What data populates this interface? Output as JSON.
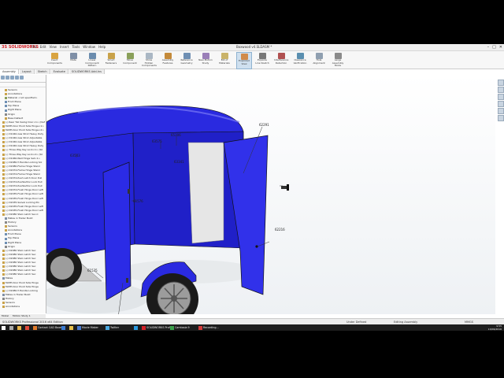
{
  "app": {
    "logo": "3S SOLIDWORKS",
    "document_title": "Boxwood v4.SLDASM *"
  },
  "menu": [
    "File",
    "Edit",
    "View",
    "Insert",
    "Tools",
    "Window",
    "Help"
  ],
  "window_controls": [
    "–",
    "□",
    "✕"
  ],
  "ribbon": [
    {
      "label": "Insert Components",
      "icon": "insert-components-icon",
      "color": "#d9a441"
    },
    {
      "label": "Mate",
      "icon": "mate-icon",
      "color": "#7f8fa6"
    },
    {
      "label": "Linear Component Pattern",
      "icon": "linear-pattern-icon",
      "color": "#6b8cae"
    },
    {
      "label": "Smart Fasteners",
      "icon": "smart-fasteners-icon",
      "color": "#c9a24a"
    },
    {
      "label": "Move Component",
      "icon": "move-component-icon",
      "color": "#8aa05a"
    },
    {
      "label": "Show Hidden Components",
      "icon": "show-hidden-icon",
      "color": "#aab7c4"
    },
    {
      "label": "Assembly Features",
      "icon": "assembly-features-icon",
      "color": "#c48a3a"
    },
    {
      "label": "Reference Geometry",
      "icon": "reference-geometry-icon",
      "color": "#6f8fb3"
    },
    {
      "label": "New Motion Study",
      "icon": "motion-study-icon",
      "color": "#9a7fb8"
    },
    {
      "label": "Bill of Materials",
      "icon": "bill-of-materials-icon",
      "color": "#c9b36a"
    },
    {
      "label": "Exploded View",
      "icon": "exploded-view-icon",
      "color": "#d08a4a"
    },
    {
      "label": "Explode Line Sketch",
      "icon": "explode-line-sketch-icon",
      "color": "#777777"
    },
    {
      "label": "Interference Detection",
      "icon": "interference-icon",
      "color": "#b05050"
    },
    {
      "label": "Clearance Verification",
      "icon": "clearance-icon",
      "color": "#5a8fb0"
    },
    {
      "label": "Hole Alignment",
      "icon": "hole-alignment-icon",
      "color": "#8f9fb0"
    },
    {
      "label": "Large Assembly Mode",
      "icon": "large-assembly-icon",
      "color": "#8a8a8a"
    }
  ],
  "command_tabs": [
    "Assembly",
    "Layout",
    "Sketch",
    "Evaluate",
    "SOLIDWORKS Add-Ins"
  ],
  "tree": [
    {
      "label": "Sensors",
      "color": "#c9a24a"
    },
    {
      "label": "Annotations",
      "color": "#c9a24a"
    },
    {
      "label": "Material <not specified>",
      "color": "#8aa05a"
    },
    {
      "label": "Front Plane",
      "color": "#6f8fb3"
    },
    {
      "label": "Top Plane",
      "color": "#6f8fb3"
    },
    {
      "label": "Right Plane",
      "color": "#6f8fb3"
    },
    {
      "label": "Origin",
      "color": "#888888"
    },
    {
      "label": "Base Default",
      "color": "#c9a24a"
    },
    {
      "label": "(-) Rear Tub Swing Door<1> (Def",
      "color": "#c9a24a"
    },
    {
      "label": "MATE-Door Pivot Side Hinge<1>",
      "color": "#c9a24a"
    },
    {
      "label": "MATE-Door Pivot Side Hinge<2>",
      "color": "#c9a24a"
    },
    {
      "label": "(-) D1040-Gas Strut Heavy Duty",
      "color": "#c9a24a"
    },
    {
      "label": "(-) D1040-Gas Strut Adjustable",
      "color": "#c9a24a"
    },
    {
      "label": "(-) D1040-Gas Strut Adjustable",
      "color": "#c9a24a"
    },
    {
      "label": "(-) D1040-Gas Strut Heavy Duty",
      "color": "#c9a24a"
    },
    {
      "label": "(-) Three Way Key Lock<1> (Sil",
      "color": "#c9a24a"
    },
    {
      "label": "(-) Three Way Key Lock<2> (Sil",
      "color": "#c9a24a"
    },
    {
      "label": "(-) D1060-Wall Hinge Set<1>",
      "color": "#c9a24a"
    },
    {
      "label": "(-) D2080-T-Handle Locking Sol",
      "color": "#c9a24a"
    },
    {
      "label": "(-) D2080-Flame Hinge Stainl",
      "color": "#c9a24a"
    },
    {
      "label": "(-) D2074-Flame Hinge Stainl",
      "color": "#c9a24a"
    },
    {
      "label": "(-) D2074-Flame Hinge Stainl",
      "color": "#c9a24a"
    },
    {
      "label": "(-) D2074-Push Latch Door Pull",
      "color": "#c9a24a"
    },
    {
      "label": "(-) D2074-Pushbutton Lock Pull",
      "color": "#c9a24a"
    },
    {
      "label": "(-) D2074-Pushbutton Lock Pull",
      "color": "#c9a24a"
    },
    {
      "label": "(-) D2074-Flush Hinge Door Left",
      "color": "#c9a24a"
    },
    {
      "label": "(-) D2035-Flush Hinge Door Left",
      "color": "#c9a24a"
    },
    {
      "label": "(-) D2035-Flush Hinge Door Left",
      "color": "#c9a24a"
    },
    {
      "label": "(-) D2035-Swivel Locking Pin",
      "color": "#c9a24a"
    },
    {
      "label": "(-) D2035-Flush Hinge Door Left",
      "color": "#c9a24a"
    },
    {
      "label": "(-) D2035-Flush Hinge Door Left",
      "color": "#c9a24a"
    },
    {
      "label": "(-) D2080 Stain Latch Sec-C",
      "color": "#c9a24a"
    },
    {
      "label": "Mates in Trailer Build",
      "color": "#7f8fa6"
    },
    {
      "label": "History",
      "color": "#888888"
    },
    {
      "label": "Sensors",
      "color": "#c9a24a"
    },
    {
      "label": "Annotations",
      "color": "#c9a24a"
    },
    {
      "label": "Front Plane",
      "color": "#6f8fb3"
    },
    {
      "label": "Top Plane",
      "color": "#6f8fb3"
    },
    {
      "label": "Right Plane",
      "color": "#6f8fb3"
    },
    {
      "label": "Origin",
      "color": "#888888"
    },
    {
      "label": "(-) D2080 Stain Latch Sec",
      "color": "#c9a24a"
    },
    {
      "label": "(-) D2080 Stain Latch Sec",
      "color": "#c9a24a"
    },
    {
      "label": "(-) D2080 Stain Latch Sec",
      "color": "#c9a24a"
    },
    {
      "label": "(-) D2080 Stain Latch Sec",
      "color": "#c9a24a"
    },
    {
      "label": "(-) D2080 Stain Latch Sec",
      "color": "#c9a24a"
    },
    {
      "label": "(-) D2080 Stain Latch Sec",
      "color": "#c9a24a"
    },
    {
      "label": "(-) D2080 Stain Latch Sec",
      "color": "#c9a24a"
    },
    {
      "label": "Mates",
      "color": "#7f8fa6"
    },
    {
      "label": "MATE-Door Pivot Side Hinge",
      "color": "#c9a24a"
    },
    {
      "label": "MATE-Door Pivot Side Hinge",
      "color": "#c9a24a"
    },
    {
      "label": "(-) D2080-T-Handle Locking",
      "color": "#c9a24a"
    },
    {
      "label": "Mates in Trailer Build",
      "color": "#7f8fa6"
    },
    {
      "label": "History",
      "color": "#888888"
    },
    {
      "label": "Sensors",
      "color": "#c9a24a"
    },
    {
      "label": "Annotations",
      "color": "#c9a24a"
    }
  ],
  "sidebar_bottom_tabs": [
    "Model",
    "Motion Study 1"
  ],
  "callouts": [
    "62291",
    "65306",
    "63575",
    "63341",
    "63543",
    "62216",
    "61535",
    "61576",
    "61578"
  ],
  "status": {
    "left": "SOLIDWORKS Professional 2016 x64 Edition",
    "mid": "Under Defined",
    "right": "Editing Assembly",
    "units": "MMGS"
  },
  "taskbar": [
    {
      "label": "",
      "icon": "windows-start-icon",
      "color": "#ffffff"
    },
    {
      "label": "",
      "icon": "search-icon",
      "color": "#aaaaaa"
    },
    {
      "label": "",
      "icon": "file-explorer-icon",
      "color": "#e8b64a"
    },
    {
      "label": "",
      "icon": "chrome-icon",
      "color": "#e04a3a"
    },
    {
      "label": "Contact CAD Boxes",
      "icon": "firefox-icon",
      "color": "#e07a2a"
    },
    {
      "label": "",
      "icon": "email-icon",
      "color": "#3a7ad0"
    },
    {
      "label": "",
      "icon": "folder-icon",
      "color": "#e8c04a"
    },
    {
      "label": "Movie Maker",
      "icon": "movie-maker-icon",
      "color": "#4a7ad0"
    },
    {
      "label": "Twitter",
      "icon": "twitter-icon",
      "color": "#4aa8e0"
    },
    {
      "label": "",
      "icon": "skype-icon",
      "color": "#2a9ae0"
    },
    {
      "label": "SOLIDWORKS Profes",
      "icon": "solidworks-icon",
      "color": "#d42027"
    },
    {
      "label": "Camtasia 9",
      "icon": "camtasia-icon",
      "color": "#3aa04a"
    },
    {
      "label": "Recording...",
      "icon": "recording-icon",
      "color": "#d43a3a"
    }
  ],
  "clock": {
    "time": "9:55",
    "date": "13/06/2016"
  }
}
